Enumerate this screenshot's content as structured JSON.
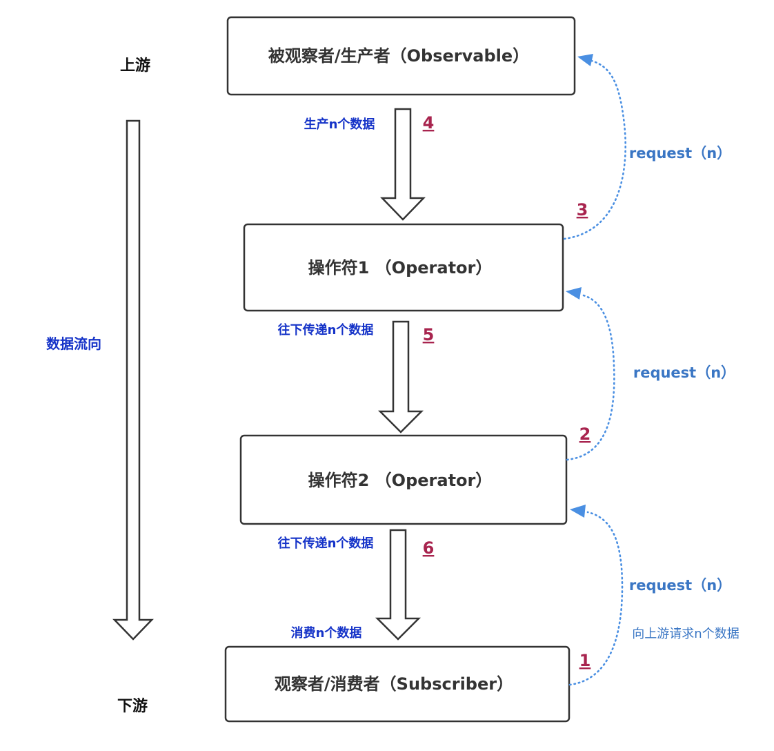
{
  "nodes": {
    "observable": "被观察者/生产者（Observable）",
    "operator1": "操作符1 （Operator）",
    "operator2": "操作符2 （Operator）",
    "subscriber": "观察者/消费者（Subscriber）"
  },
  "side": {
    "upstream": "上游",
    "downstream": "下游",
    "flow_direction": "数据流向"
  },
  "flow_labels": {
    "produce": "生产n个数据",
    "pass1": "往下传递n个数据",
    "pass2": "往下传递n个数据",
    "consume": "消费n个数据"
  },
  "steps": {
    "s1": "1",
    "s2": "2",
    "s3": "3",
    "s4": "4",
    "s5": "5",
    "s6": "6"
  },
  "requests": {
    "r1": "request（n）",
    "r2": "request（n）",
    "r3": "request（n）",
    "note": "向上游请求n个数据"
  },
  "colors": {
    "box_border": "#333333",
    "flow_label": "#1533c8",
    "step_number": "#a8244e",
    "request": "#3a76c4",
    "dotted_line": "#4a8fe2"
  }
}
